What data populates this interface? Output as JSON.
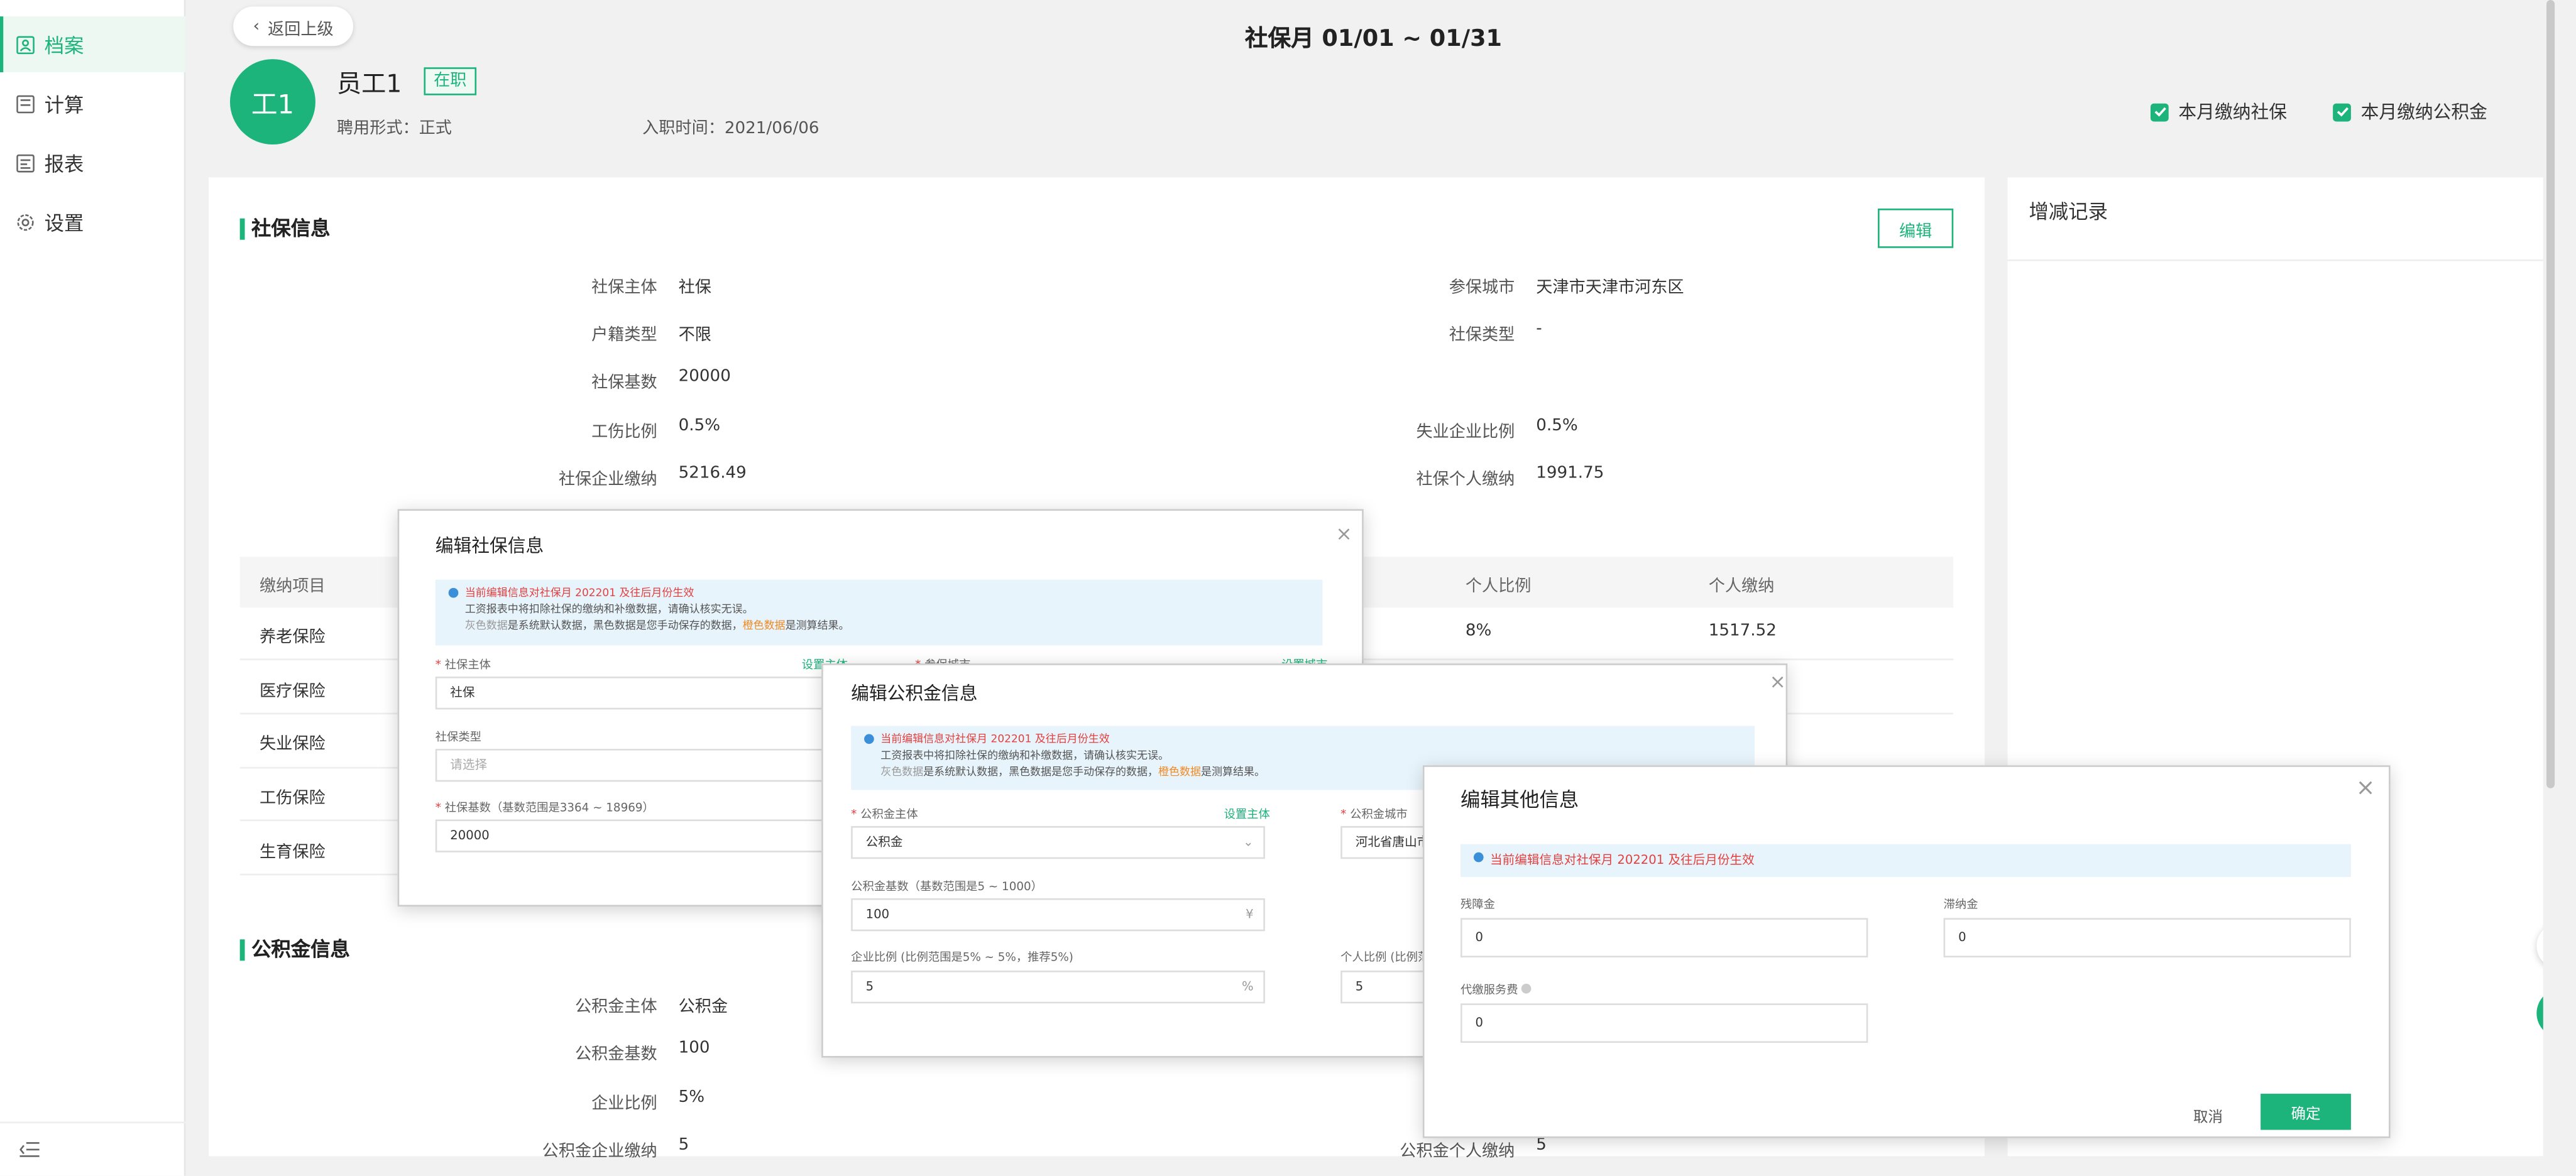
{
  "sidebar": {
    "items": [
      {
        "label": "档案"
      },
      {
        "label": "计算"
      },
      {
        "label": "报表"
      },
      {
        "label": "设置"
      }
    ]
  },
  "header": {
    "back_label": "返回上级",
    "title": "社保月 01/01 ~ 01/31",
    "avatar_text": "工1",
    "employee_name": "员工1",
    "status_badge": "在职",
    "employment_type": "聘用形式：正式",
    "hire_date": "入职时间：2021/06/06",
    "social_checkbox": "本月缴纳社保",
    "fund_checkbox": "本月缴纳公积金"
  },
  "social": {
    "section_title": "社保信息",
    "edit_label": "编辑",
    "fields": [
      {
        "label": "社保主体",
        "value": "社保"
      },
      {
        "label": "参保城市",
        "value": "天津市天津市河东区"
      },
      {
        "label": "户籍类型",
        "value": "不限"
      },
      {
        "label": "社保类型",
        "value": "-"
      },
      {
        "label": "社保基数",
        "value": "20000"
      },
      {
        "label": "工伤比例",
        "value": "0.5%"
      },
      {
        "label": "失业企业比例",
        "value": "0.5%"
      },
      {
        "label": "社保企业缴纳",
        "value": "5216.49"
      },
      {
        "label": "社保个人缴纳",
        "value": "1991.75"
      }
    ],
    "table": {
      "headers": [
        "缴纳项目",
        "个人比例",
        "个人缴纳"
      ],
      "rows": [
        {
          "item": "养老保险",
          "ratio": "8%",
          "amount": "1517.52"
        },
        {
          "item": "医疗保险"
        },
        {
          "item": "失业保险"
        },
        {
          "item": "工伤保险"
        },
        {
          "item": "生育保险"
        }
      ]
    }
  },
  "fund": {
    "section_title": "公积金信息",
    "fields": [
      {
        "label": "公积金主体",
        "value": "公积金"
      },
      {
        "label": "公积金基数",
        "value": "100"
      },
      {
        "label": "企业比例",
        "value": "5%"
      },
      {
        "label": "公积金企业缴纳",
        "value": "5"
      },
      {
        "label": "公积金个人缴纳",
        "value": "5"
      }
    ]
  },
  "right_panel": {
    "title": "增减记录"
  },
  "dialog_social": {
    "title": "编辑社保信息",
    "notice_line1": "当前编辑信息对社保月 202201 及往后月份生效",
    "notice_line2": "工资报表中将扣除社保的缴纳和补缴数据，请确认核实无误。",
    "notice_line3a": "灰色数据",
    "notice_line3b": "是系统默认数据，黑色数据是您手动保存的数据，",
    "notice_line3c": "橙色数据",
    "notice_line3d": "是测算结果。",
    "entity_label": "社保主体",
    "entity_link": "设置主体",
    "city_label": "参保城市",
    "city_link": "设置城市",
    "entity_value": "社保",
    "type_label": "社保类型",
    "type_placeholder": "请选择",
    "base_label": "社保基数（基数范围是3364 ~ 18969）",
    "base_value": "20000"
  },
  "dialog_fund": {
    "title": "编辑公积金信息",
    "notice_line1": "当前编辑信息对社保月 202201 及往后月份生效",
    "notice_line2": "工资报表中将扣除社保的缴纳和补缴数据，请确认核实无误。",
    "notice_line3a": "灰色数据",
    "notice_line3b": "是系统默认数据，黑色数据是您手动保存的数据，",
    "notice_line3c": "橙色数据",
    "notice_line3d": "是测算结果。",
    "entity_label": "公积金主体",
    "entity_link": "设置主体",
    "entity_value": "公积金",
    "city_label": "公积金城市",
    "city_value": "河北省唐山市",
    "base_label": "公积金基数（基数范围是5 ~ 1000）",
    "base_value": "100",
    "base_suffix": "¥",
    "corp_ratio_label": "企业比例 (比例范围是5% ~ 5%，推荐5%)",
    "corp_ratio_value": "5",
    "corp_ratio_suffix": "%",
    "personal_ratio_label": "个人比例 (比例范",
    "personal_ratio_value": "5"
  },
  "dialog_other": {
    "title": "编辑其他信息",
    "notice": "当前编辑信息对社保月 202201 及往后月份生效",
    "disability_label": "残障金",
    "disability_value": "0",
    "union_label": "滞纳金",
    "union_value": "0",
    "agency_label": "代缴服务费",
    "agency_value": "0",
    "cancel_label": "取消",
    "ok_label": "确定"
  },
  "colors": {
    "accent": "#1db47c",
    "notice_bg": "#e8f4fb",
    "warning": "#e34040"
  }
}
